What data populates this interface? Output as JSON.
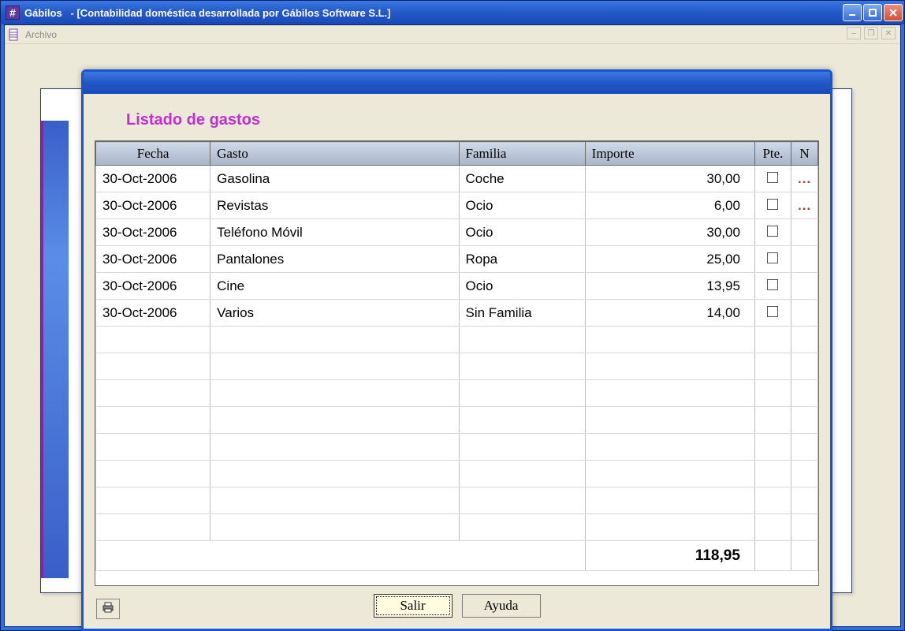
{
  "outer": {
    "app_name": "Gábilos",
    "subtitle": "- [Contabilidad doméstica desarrollada por Gábilos Software S.L.]",
    "menu_file": "Archivo"
  },
  "dialog": {
    "heading": "Listado de gastos",
    "columns": {
      "fecha": "Fecha",
      "gasto": "Gasto",
      "familia": "Familia",
      "importe": "Importe",
      "pte": "Pte.",
      "n": "N"
    },
    "rows": [
      {
        "fecha": "30-Oct-2006",
        "gasto": "Gasolina",
        "familia": "Coche",
        "importe": "30,00",
        "note": "..."
      },
      {
        "fecha": "30-Oct-2006",
        "gasto": "Revistas",
        "familia": "Ocio",
        "importe": "6,00",
        "note": "..."
      },
      {
        "fecha": "30-Oct-2006",
        "gasto": "Teléfono Móvil",
        "familia": "Ocio",
        "importe": "30,00",
        "note": ""
      },
      {
        "fecha": "30-Oct-2006",
        "gasto": "Pantalones",
        "familia": "Ropa",
        "importe": "25,00",
        "note": ""
      },
      {
        "fecha": "30-Oct-2006",
        "gasto": "Cine",
        "familia": "Ocio",
        "importe": "13,95",
        "note": ""
      },
      {
        "fecha": "30-Oct-2006",
        "gasto": "Varios",
        "familia": "Sin Familia",
        "importe": "14,00",
        "note": ""
      }
    ],
    "empty_rows": 8,
    "total": "118,95",
    "buttons": {
      "salir": "Salir",
      "ayuda": "Ayuda"
    }
  }
}
